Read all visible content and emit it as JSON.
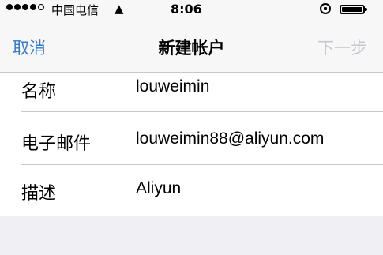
{
  "status_bar": {
    "carrier": "中国电信",
    "wifi_icon": "wifi-icon",
    "time": "8:06"
  },
  "nav": {
    "cancel_label": "取消",
    "title": "新建帐户",
    "next_label": "下一步"
  },
  "fields": [
    {
      "label": "名称",
      "value": "louweimin"
    },
    {
      "label": "电子邮件",
      "value": "louweimin88@aliyun.com"
    },
    {
      "label": "描述",
      "value": "Aliyun"
    }
  ],
  "colors": {
    "accent": "#2f7bd3",
    "disabled": "#c7c7cc",
    "background": "#efeff4"
  }
}
